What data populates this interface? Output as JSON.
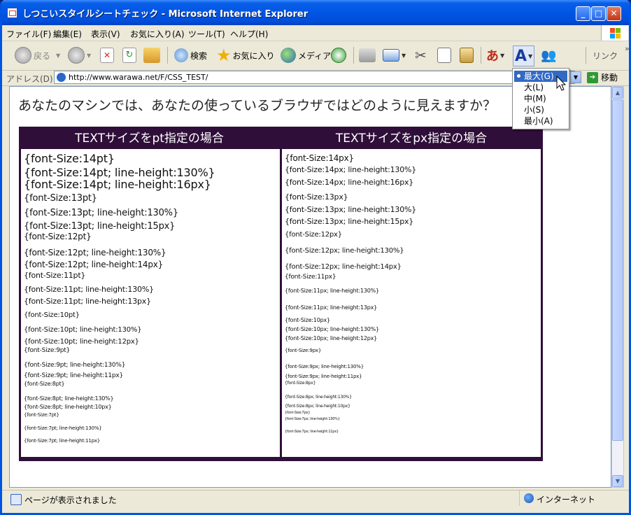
{
  "window": {
    "title": "しつこいスタイルシートチェック - Microsoft Internet Explorer"
  },
  "menu": [
    "ファイル(F)",
    "編集(E)",
    "表示(V)",
    "お気に入り(A)",
    "ツール(T)",
    "ヘルプ(H)"
  ],
  "toolbar": {
    "back": "戻る",
    "search": "検索",
    "favorites": "お気に入り",
    "media": "メディア",
    "links": "リンク"
  },
  "address": {
    "label": "アドレス(D)",
    "url": "http://www.warawa.net/F/CSS_TEST/",
    "go": "移動"
  },
  "page": {
    "question": "あなたのマシンでは、あなたの使っているブラウザではどのように見えますか？",
    "pt_header": "TEXTサイズをpt指定の場合",
    "px_header": "TEXTサイズをpx指定の場合",
    "pt_lines": [
      "{font-Size:14pt}",
      "{font-Size:14pt; line-height:130%}",
      "{font-Size:14pt; line-height:16px}",
      "{font-Size:13pt}",
      "{font-Size:13pt; line-height:130%}",
      "{font-Size:13pt; line-height:15px}",
      "{font-Size:12pt}",
      "{font-Size:12pt; line-height:130%}",
      "{font-Size:12pt; line-height:14px}",
      "{font-Size:11pt}",
      "{font-Size:11pt; line-height:130%}",
      "{font-Size:11pt; line-height:13px}",
      "{font-Size:10pt}",
      "{font-Size:10pt; line-height:130%}",
      "{font-Size:10pt; line-height:12px}",
      "{font-Size:9pt}",
      "{font-Size:9pt; line-height:130%}",
      "{font-Size:9pt; line-height:11px}",
      "{font-Size:8pt}",
      "{font-Size:8pt; line-height:130%}",
      "{font-Size:8pt; line-height:10px}",
      "{font-Size:7pt}",
      "{font-Size:7pt; line-height:130%}",
      "{font-Size:7pt; line-height:11px}"
    ],
    "px_lines": [
      "{font-Size:14px}",
      "{font-Size:14px; line-height:130%}",
      "{font-Size:14px; line-height:16px}",
      "{font-Size:13px}",
      "{font-Size:13px; line-height:130%}",
      "{font-Size:13px; line-height:15px}",
      "{font-Size:12px}",
      "{font-Size:12px; line-height:130%}",
      "{font-Size:12px; line-height:14px}",
      "{font-Size:11px}",
      "{font-Size:11px; line-height:130%}",
      "{font-Size:11px; line-height:13px}",
      "{font-Size:10px}",
      "{font-Size:10px; line-height:130%}",
      "{font-Size:10px; line-height:12px}",
      "{font-Size:9px}",
      "{font-Size:9px; line-height:130%}",
      "{font-Size:9px; line-height:11px}",
      "{font-Size:8px}",
      "{font-Size:8px; line-height:130%}",
      "{font-Size:8px; line-height:10px}",
      "{font-Size:7px}",
      "{font-Size:7px; line-height:130%}",
      "{font-Size:7px; line-height:11px}"
    ]
  },
  "text_size_menu": {
    "items": [
      "最大(G)",
      "大(L)",
      "中(M)",
      "小(S)",
      "最小(A)"
    ],
    "selected": "最大(G)"
  },
  "status": {
    "text": "ページが表示されました",
    "zone": "インターネット"
  },
  "colors": {
    "titlebar": "#0055e5",
    "table_bg": "#300e3a",
    "menu_highlight": "#316ac5"
  }
}
